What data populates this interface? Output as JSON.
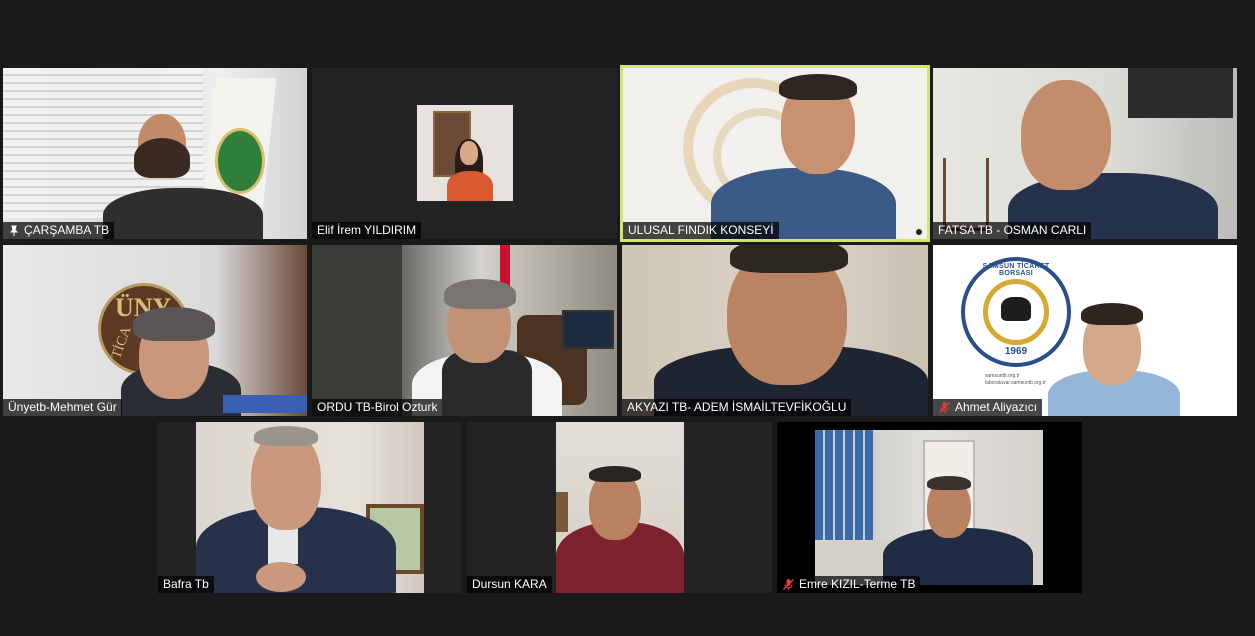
{
  "participants": [
    {
      "name": "ÇARŞAMBA TB",
      "icon": "pin-icon"
    },
    {
      "name": "Elif İrem YILDIRIM",
      "icon": ""
    },
    {
      "name": "ULUSAL FINDIK KONSEYİ",
      "icon": "",
      "active_speaker": true
    },
    {
      "name": "FATSA TB - OSMAN CARLI",
      "icon": ""
    },
    {
      "name": "Ünyetb-Mehmet Gür",
      "icon": ""
    },
    {
      "name": "ORDU TB-Birol Ozturk",
      "icon": ""
    },
    {
      "name": "AKYAZI TB- ADEM İSMAİLTEVFİKOĞLU",
      "icon": ""
    },
    {
      "name": "Ahmet Aliyazıcı",
      "icon": "muted-mic-icon"
    },
    {
      "name": "Bafra Tb",
      "icon": ""
    },
    {
      "name": "Dursun KARA",
      "icon": ""
    },
    {
      "name": "Emre KIZIL-Terme TB",
      "icon": "muted-mic-icon"
    }
  ],
  "logos": {
    "samsun_ring_text": "SAMSUN TİCARET BORSASI",
    "samsun_year": "1969",
    "samsun_url1": "samsuntb.org.tr",
    "samsun_url2": "laboratuvar.samsuntb.org.tr",
    "unye_text": "ÜNY",
    "unye_sub": "TİCA"
  },
  "colors": {
    "background": "#1a1a1a",
    "active_border": "#cfe66a",
    "muted_icon": "#e0393e"
  }
}
